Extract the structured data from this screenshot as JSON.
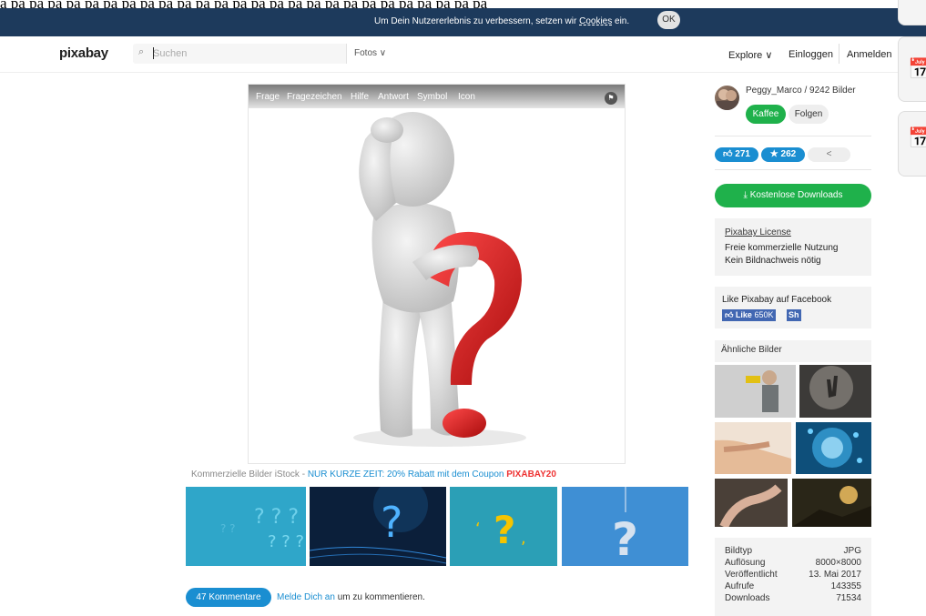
{
  "cookie_bar": {
    "text": "Um Dein Nutzererlebnis zu verbessern, setzen wir",
    "link": "Cookies",
    "text_end": "ein.",
    "ok_label": "OK"
  },
  "header": {
    "logo": "pixabay",
    "search_placeholder": "Suchen",
    "media_type": "Fotos ∨",
    "explore": "Explore ∨",
    "login": "Einloggen",
    "register": "Anmelden"
  },
  "image": {
    "tags": [
      "Frage",
      "Fragezeichen",
      "Hilfe",
      "Antwort",
      "Symbol",
      "Icon"
    ],
    "flag_icon": "flag-icon"
  },
  "istock": {
    "prefix": "Kommerzielle Bilder iStock - ",
    "promo": "NUR KURZE ZEIT: 20% Rabatt mit dem Coupon ",
    "code": "PIXABAY20"
  },
  "comments": {
    "count_label": "47 Kommentare",
    "link": "Melde Dich an",
    "suffix": " um zu kommentieren."
  },
  "sidebar": {
    "author": "Peggy_Marco / 9242 Bilder",
    "kaffee": "Kaffee",
    "folgen": "Folgen",
    "likes": "271",
    "favorites": "262",
    "download_label": "Kostenlose Downloads",
    "license_title": "Pixabay License",
    "license_line1": "Freie kommerzielle Nutzung",
    "license_line2": "Kein Bildnachweis nötig",
    "fb_title": "Like Pixabay auf Facebook",
    "fb_like": "Like",
    "fb_count": "650K",
    "fb_share": "Sh",
    "similar_title": "Ähnliche Bilder"
  },
  "details": [
    {
      "label": "Bildtyp",
      "value": "JPG"
    },
    {
      "label": "Auflösung",
      "value": "8000×8000"
    },
    {
      "label": "Veröffentlicht",
      "value": "13. Mai 2017"
    },
    {
      "label": "Aufrufe",
      "value": "143355"
    },
    {
      "label": "Downloads",
      "value": "71534"
    }
  ],
  "colors": {
    "brand_green": "#1fb14b",
    "accent_blue": "#1a8ed1",
    "cookie_bar": "#1d3a5c"
  }
}
